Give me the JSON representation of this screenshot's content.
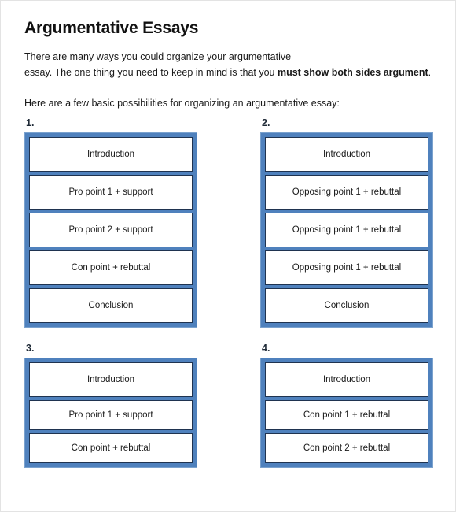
{
  "document": {
    "title": "Argumentative Essays",
    "intro_line_one": "There are many ways you could organize your argumentative",
    "intro_line_two_prefix": "essay.   The one thing you need to keep in mind is that you ",
    "intro_bold": "must show both sides argument",
    "intro_suffix": ".",
    "lead_in": "Here are a few basic possibilities for organizing an argumentative essay:"
  },
  "colors": {
    "frame_blue": "#4F81BD",
    "box_border": "#1F3350",
    "text": "#1a1a1a",
    "page_border": "#e3e3e3"
  },
  "diagrams": [
    {
      "number": "1.",
      "items": [
        "Introduction",
        "Pro point 1 + support",
        "Pro point 2 + support",
        "Con point + rebuttal",
        "Conclusion"
      ]
    },
    {
      "number": "2.",
      "items": [
        "Introduction",
        "Opposing point 1 + rebuttal",
        "Opposing point 1 + rebuttal",
        "Opposing point 1 + rebuttal",
        "Conclusion"
      ]
    },
    {
      "number": "3.",
      "items": [
        "Introduction",
        "Pro point 1 + support",
        "Con point + rebuttal"
      ]
    },
    {
      "number": "4.",
      "items": [
        "Introduction",
        "Con point 1 + rebuttal",
        "Con point 2 + rebuttal"
      ]
    }
  ]
}
